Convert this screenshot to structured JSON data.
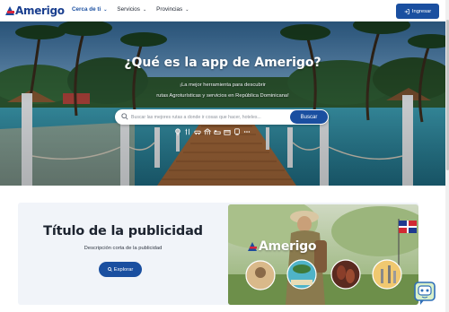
{
  "brand": {
    "name": "Amerigo",
    "colors": {
      "primary": "#1a4fa0",
      "accent_red": "#d7263d",
      "logo_blue": "#1a3f8f"
    }
  },
  "nav": {
    "items": [
      {
        "label": "Cerca de ti",
        "icon": "chevron-down-icon"
      },
      {
        "label": "Servicios",
        "icon": "chevron-down-icon"
      },
      {
        "label": "Provincias",
        "icon": "chevron-down-icon"
      }
    ],
    "login_label": "Ingresar",
    "login_icon": "login-icon"
  },
  "hero": {
    "title": "¿Qué es la app de Amerigo?",
    "subtitle_line1": "¡La mejor herramienta para descubrir",
    "subtitle_line2": "rutas Agroturísticas y servicios en República Dominicana!",
    "search": {
      "placeholder": "Buscar las mejores rutas a donde ir cosas que hacer, hoteles...",
      "button_label": "Buscar",
      "icon": "search-icon"
    },
    "category_icons": [
      "tree-icon",
      "restaurant-icon",
      "car-icon",
      "museum-icon",
      "bed-icon",
      "store-icon",
      "train-icon",
      "more-icon"
    ]
  },
  "ad": {
    "title": "Título de la publicidad",
    "description": "Descripción corta de la publicidad",
    "button_label": "Explorar",
    "button_icon": "search-icon",
    "image_brand": "Amerigo"
  },
  "chat": {
    "icon": "chat-bot-icon"
  }
}
